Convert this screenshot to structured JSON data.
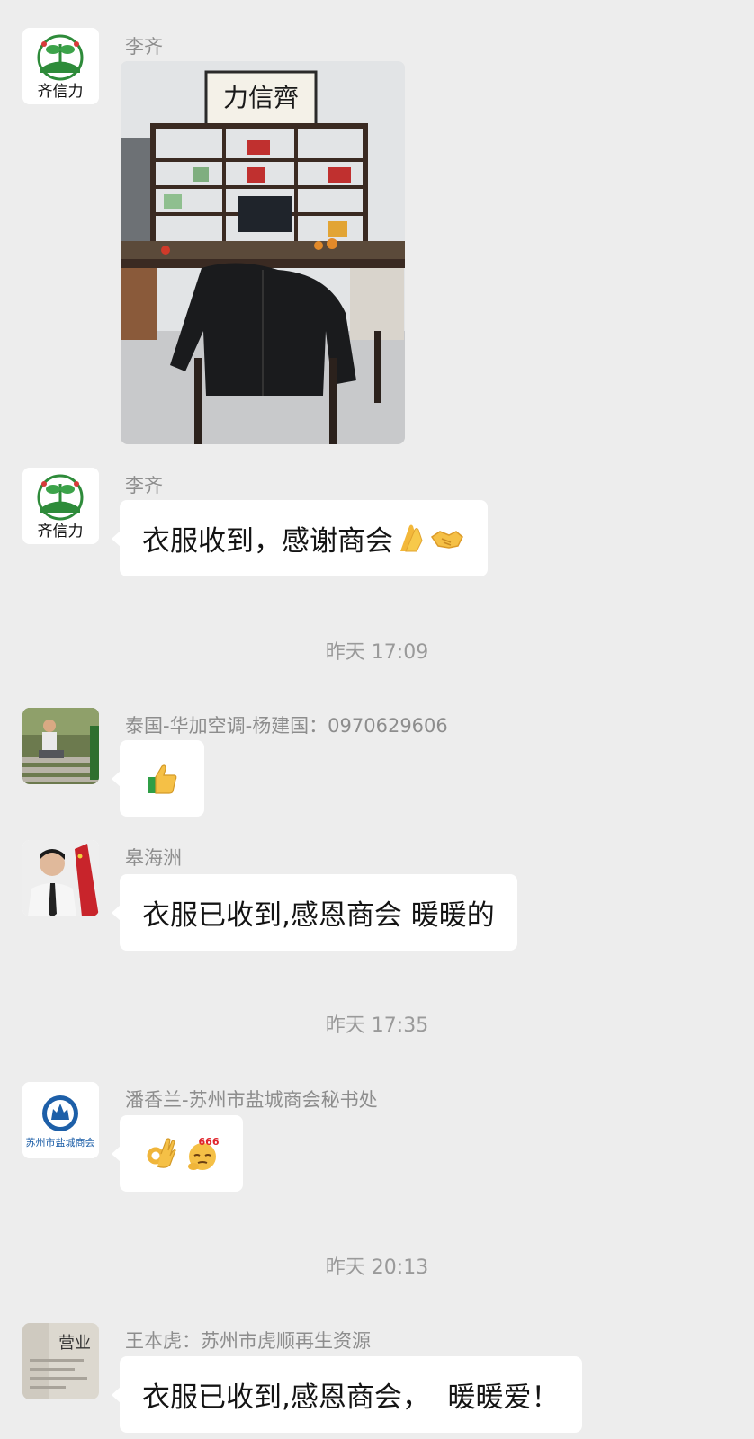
{
  "messages": [
    {
      "sender": "李齐",
      "avatar_text": "齐信力",
      "type": "image",
      "image": {
        "calligraphy": "力信齊",
        "subject": "tea room with shelves, table and black jacket on chair"
      }
    },
    {
      "sender": "李齐",
      "avatar_text": "齐信力",
      "type": "text",
      "text": "衣服收到，感谢商会",
      "emojis": [
        "pray-emoji",
        "handshake-emoji"
      ]
    },
    {
      "sender": "泰国-华加空调-杨建国：0970629606",
      "type": "emoji",
      "emojis": [
        "thumbs-up-emoji"
      ]
    },
    {
      "sender": "皋海洲",
      "type": "text",
      "text": "衣服已收到,感恩商会 暖暖的"
    },
    {
      "sender": "潘香兰-苏州市盐城商会秘书处",
      "avatar_text": "苏州市盐城商会",
      "type": "emoji",
      "emojis": [
        "ok-hand-emoji",
        "666-emoji"
      ],
      "emoji_badge": "666"
    },
    {
      "sender": "王本虎：苏州市虎顺再生资源",
      "avatar_text": "营业",
      "type": "text",
      "text": "衣服已收到,感恩商会，  暖暖爱！"
    }
  ],
  "timestamps": [
    "昨天 17:09",
    "昨天 17:35",
    "昨天 20:13"
  ],
  "colors": {
    "background": "#ededed",
    "bubble": "#ffffff",
    "meta_text": "#8d8d8d",
    "logo_green": "#2e8b3a",
    "badge_blue": "#1d5fa8"
  }
}
